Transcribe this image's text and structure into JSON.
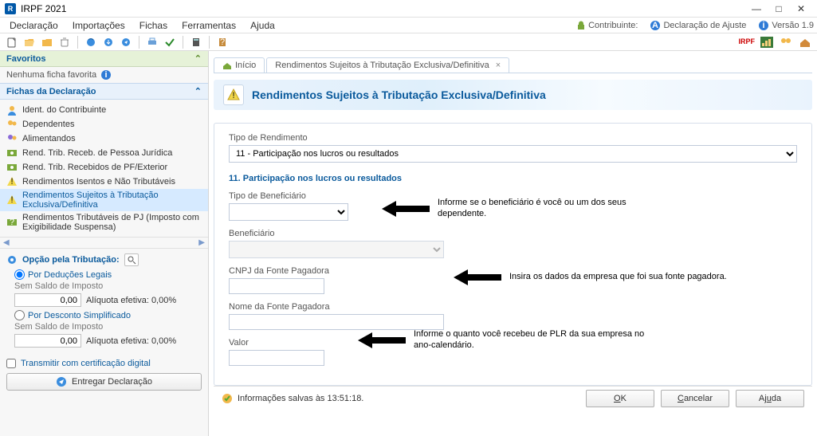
{
  "window": {
    "title": "IRPF 2021"
  },
  "menu": {
    "items": [
      "Declaração",
      "Importações",
      "Fichas",
      "Ferramentas",
      "Ajuda"
    ],
    "contribuinte_label": "Contribuinte:",
    "decl_ajuste_label": "Declaração de Ajuste",
    "versao_label": "Versão 1.9"
  },
  "toolbar_right": {
    "irpf_label": "IRPF"
  },
  "sidebar": {
    "fav_title": "Favoritos",
    "fav_empty": "Nenhuma ficha favorita",
    "fichas_title": "Fichas da Declaração",
    "items": [
      {
        "label": "Ident. do Contribuinte"
      },
      {
        "label": "Dependentes"
      },
      {
        "label": "Alimentandos"
      },
      {
        "label": "Rend. Trib. Receb. de Pessoa Jurídica"
      },
      {
        "label": "Rend. Trib. Recebidos de PF/Exterior"
      },
      {
        "label": "Rendimentos Isentos e Não Tributáveis"
      },
      {
        "label": "Rendimentos Sujeitos à Tributação Exclusiva/Definitiva"
      },
      {
        "label": "Rendimentos Tributáveis de PJ (Imposto com Exigibilidade Suspensa)"
      }
    ],
    "tax_option_label": "Opção pela Tributação:",
    "opt1": "Por Deduções Legais",
    "opt1_sub": "Sem Saldo de Imposto",
    "opt2": "Por Desconto Simplificado",
    "opt2_sub": "Sem Saldo de Imposto",
    "value": "0,00",
    "aliquota": "Alíquota efetiva: 0,00%",
    "cert_label": "Transmitir com certificação digital",
    "deliver_label": "Entregar Declaração"
  },
  "tabs": {
    "t0": "Início",
    "t1": "Rendimentos Sujeitos à Tributação Exclusiva/Definitiva"
  },
  "page": {
    "title": "Rendimentos Sujeitos à Tributação Exclusiva/Definitiva",
    "tipo_rend_label": "Tipo de Rendimento",
    "tipo_rend_value": "11 - Participação nos lucros ou resultados",
    "subtitle": "11. Participação nos lucros ou resultados",
    "f_benef_tipo": "Tipo de Beneficiário",
    "f_benef": "Beneficiário",
    "f_cnpj": "CNPJ da Fonte Pagadora",
    "f_nome_fonte": "Nome da Fonte Pagadora",
    "f_valor": "Valor"
  },
  "annotations": {
    "a1": "Informe se o beneficiário é você ou um dos seus dependente.",
    "a2": "Insira os dados da empresa que foi sua fonte pagadora.",
    "a3": "Informe o quanto você recebeu de PLR da sua empresa no ano-calendário."
  },
  "footer": {
    "status": "Informações salvas às 13:51:18.",
    "ok": "OK",
    "cancel": "Cancelar",
    "help": "Ajuda"
  }
}
